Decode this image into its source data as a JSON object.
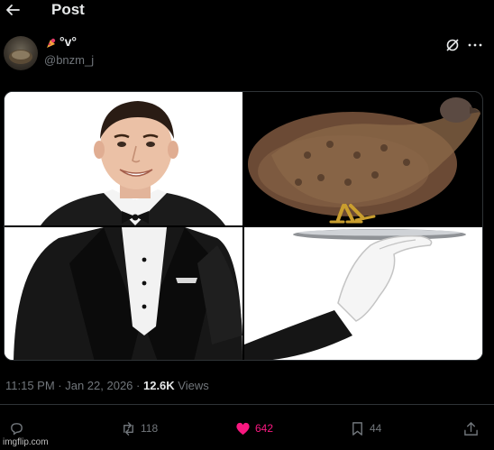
{
  "header": {
    "title": "Post"
  },
  "author": {
    "display_name": "°v°",
    "handle": "@bnzm_j"
  },
  "post": {
    "timestamp": "11:15 PM · Jan 22, 2026",
    "separator": " · ",
    "views_count": "12.6K",
    "views_label": " Views"
  },
  "actions": {
    "reply_count": "",
    "repost_count": "118",
    "like_count": "642",
    "bookmark_count": "44"
  },
  "colors": {
    "accent_like": "#f91880",
    "muted": "#71767b",
    "text": "#e7e9ea"
  },
  "icons": [
    "back-arrow-icon",
    "grok-icon",
    "more-icon",
    "reply-icon",
    "repost-icon",
    "heart-icon",
    "bookmark-icon",
    "share-icon"
  ],
  "watermark": "imgflip.com"
}
